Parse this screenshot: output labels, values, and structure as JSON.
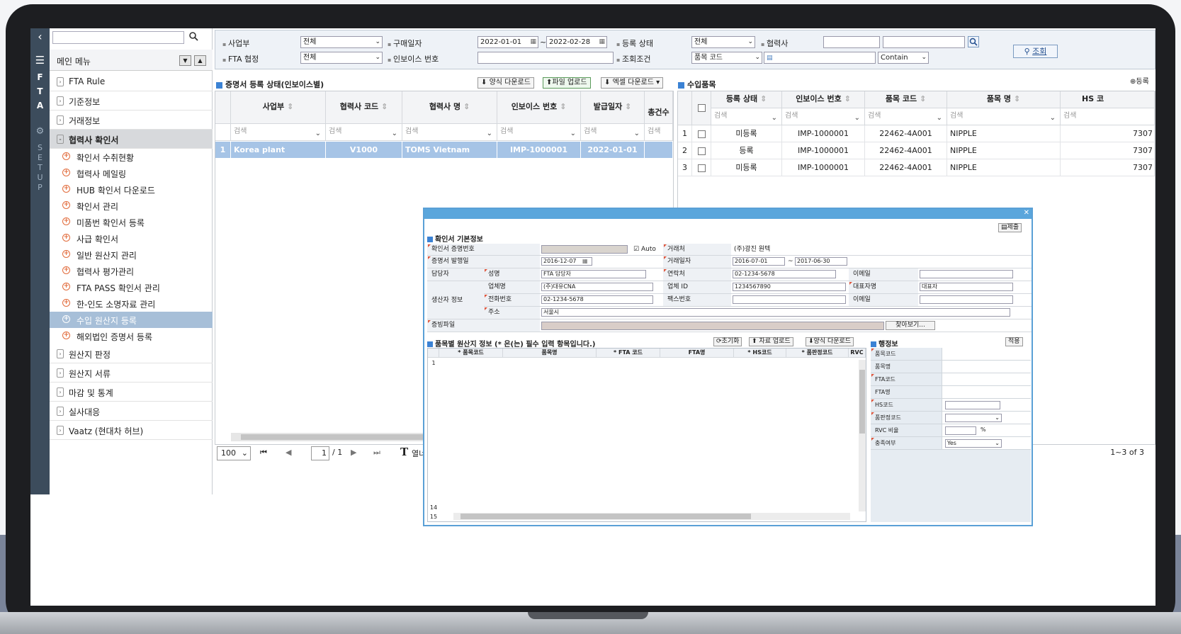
{
  "sidebar": {
    "strip_top": [
      "F",
      "T",
      "A"
    ],
    "strip_bottom": [
      "S",
      "E",
      "T",
      "U",
      "P"
    ],
    "menu_title": "메인 메뉴",
    "items": [
      {
        "label": "FTA Rule"
      },
      {
        "label": "기준정보"
      },
      {
        "label": "거래정보"
      },
      {
        "label": "협력사 확인서"
      }
    ],
    "sub_items": [
      {
        "label": "확인서 수취현황"
      },
      {
        "label": "협력사 메일링"
      },
      {
        "label": "HUB 확인서 다운로드"
      },
      {
        "label": "확인서 관리"
      },
      {
        "label": "미품번 확인서 등록"
      },
      {
        "label": "사급 확인서"
      },
      {
        "label": "일반 원산지 관리"
      },
      {
        "label": "협력사 평가관리"
      },
      {
        "label": "FTA PASS 확인서 관리"
      },
      {
        "label": "한-인도 소명자료 관리"
      },
      {
        "label": "수입 원산지 등록"
      },
      {
        "label": "해외법인 증명서 등록"
      }
    ],
    "items2": [
      {
        "label": "원산지 판정"
      },
      {
        "label": "원산지 서류"
      },
      {
        "label": "마감 및 통계"
      },
      {
        "label": "실사대응"
      },
      {
        "label": "Vaatz (현대차 허브)"
      }
    ]
  },
  "filter": {
    "biz_label": "사업부",
    "biz_value": "전체",
    "fta_label": "FTA 협정",
    "fta_value": "전체",
    "buy_date_label": "구매일자",
    "date_from": "2022-01-01",
    "date_to": "2022-02-28",
    "tilde": "~",
    "invoice_label": "인보이스 번호",
    "reg_status_label": "등록 상태",
    "reg_status_value": "전체",
    "query_label": "조회조건",
    "query_field": "품목 코드",
    "partner_label": "협력사",
    "contain": "Contain",
    "search_btn": "조회"
  },
  "left_panel": {
    "title": "증명서 등록 상태(인보이스별)",
    "btn_template": "양식 다운로드",
    "btn_upload": "파일 업로드",
    "btn_excel": "엑셀 다운로드",
    "headers": [
      "사업부",
      "협력사 코드",
      "협력사 명",
      "인보이스 번호",
      "발급일자",
      "총건수"
    ],
    "filter_placeholder": "검색",
    "row": {
      "no": "1",
      "biz": "Korea plant",
      "code": "V1000",
      "name": "TOMS Vietnam",
      "invoice": "IMP-1000001",
      "date": "2022-01-01"
    }
  },
  "right_panel": {
    "title": "수입품목",
    "btn_register": "등록",
    "headers": [
      "등록 상태",
      "인보이스 번호",
      "품목 코드",
      "품목 명",
      "HS 코"
    ],
    "filter_placeholder": "검색",
    "rows": [
      {
        "no": "1",
        "status": "미등록",
        "invoice": "IMP-1000001",
        "code": "22462-4A001",
        "name": "NIPPLE",
        "hs": "7307"
      },
      {
        "no": "2",
        "status": "등록",
        "invoice": "IMP-1000001",
        "code": "22462-4A001",
        "name": "NIPPLE",
        "hs": "7307"
      },
      {
        "no": "3",
        "status": "미등록",
        "invoice": "IMP-1000001",
        "code": "22462-4A001",
        "name": "NIPPLE",
        "hs": "7307"
      }
    ]
  },
  "pager": {
    "page_size": "100",
    "page": "1",
    "total_pages": "/ 1",
    "open_label": "열너비",
    "range": "1~3 of 3"
  },
  "dialog": {
    "submit": "제출",
    "section1": "확인서 기본정보",
    "cert_no": "확인서 증명번호",
    "auto": "Auto",
    "trader": "거래처",
    "trader_val": "(주)광진 원텍",
    "issue_date": "증명서 발행일",
    "issue_val": "2016-12-07",
    "trade_date": "거래일자",
    "trade_from": "2016-07-01",
    "trade_to": "2017-06-30",
    "manager": "담당자",
    "name_l": "성명",
    "name_v": "FTA 담당자",
    "contact_l": "연락처",
    "contact_v": "02-1234-5678",
    "email_l": "이메일",
    "producer": "생산자 정보",
    "company_l": "업체명",
    "company_v": "(주)대유CNA",
    "bizid_l": "업체 ID",
    "bizid_v": "1234567890",
    "ceo_l": "대표자명",
    "ceo_v": "대표자",
    "phone_l": "전화번호",
    "phone_v": "02-1234-5678",
    "fax_l": "팩스번호",
    "email2_l": "이메일",
    "addr_l": "주소",
    "addr_v": "서울시",
    "evidence": "증빙파일",
    "browse": "찾아보기...",
    "section2": "품목별 원산지 정보 (* 은(는) 필수 입력 항목입니다.)",
    "init": "초기화",
    "data_upload": "자료 업로드",
    "tmpl_dl": "양식 다운로드",
    "sub_headers": [
      "* 품목코드",
      "품목명",
      "* FTA 코드",
      "FTA명",
      "* HS코드",
      "* 품판정코드",
      "RVC"
    ],
    "row_nums": [
      "1",
      "14",
      "15"
    ],
    "section3": "행정보",
    "apply": "적용",
    "side_rows": [
      "품목코드",
      "품목명",
      "FTA코드",
      "FTA명",
      "HS코드",
      "품판정코드",
      "RVC 비율",
      "충족여부"
    ],
    "percent": "%",
    "yes": "Yes"
  }
}
